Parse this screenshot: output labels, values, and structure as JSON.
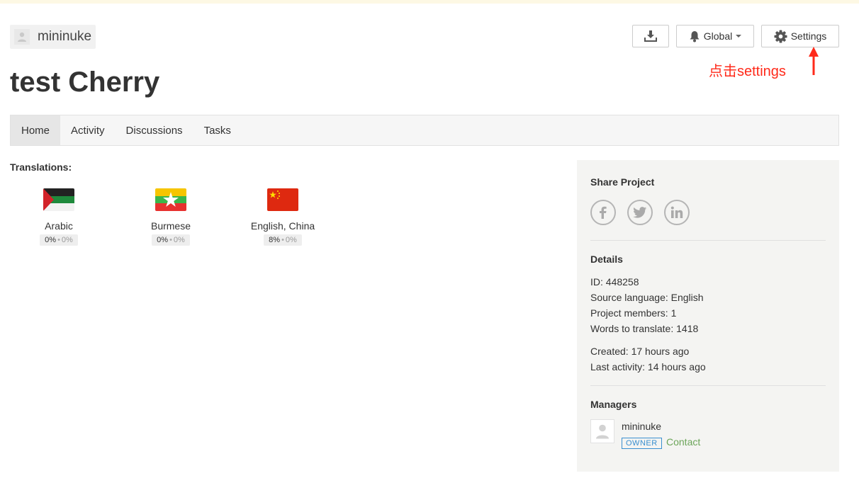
{
  "header": {
    "owner_name": "mininuke",
    "project_title": "test Cherry",
    "global_label": "Global",
    "settings_label": "Settings"
  },
  "annotation": {
    "text": "点击settings",
    "color": "#ff2a1a"
  },
  "tabs": [
    {
      "label": "Home",
      "active": true
    },
    {
      "label": "Activity",
      "active": false
    },
    {
      "label": "Discussions",
      "active": false
    },
    {
      "label": "Tasks",
      "active": false
    }
  ],
  "translations": {
    "heading": "Translations:",
    "languages": [
      {
        "name": "Arabic",
        "flag": "arabic-flag-icon",
        "translated": "0%",
        "approved": "0%"
      },
      {
        "name": "Burmese",
        "flag": "myanmar-flag-icon",
        "translated": "0%",
        "approved": "0%"
      },
      {
        "name": "English, China",
        "flag": "china-flag-icon",
        "translated": "8%",
        "approved": "0%"
      }
    ]
  },
  "sidebar": {
    "share_heading": "Share Project",
    "social": [
      "facebook-icon",
      "twitter-icon",
      "linkedin-icon"
    ],
    "details_heading": "Details",
    "details": {
      "id": "ID: 448258",
      "source_language": "Source language: English",
      "members": "Project members: 1",
      "words": "Words to translate: 1418",
      "created": "Created: 17 hours ago",
      "last_activity": "Last activity: 14 hours ago"
    },
    "managers_heading": "Managers",
    "manager": {
      "name": "mininuke",
      "badge": "OWNER",
      "contact_label": "Contact"
    }
  },
  "colors": {
    "accent_link": "#6ca55a",
    "owner_badge": "#3a8fd0",
    "topbar": "#fdf8e4"
  }
}
